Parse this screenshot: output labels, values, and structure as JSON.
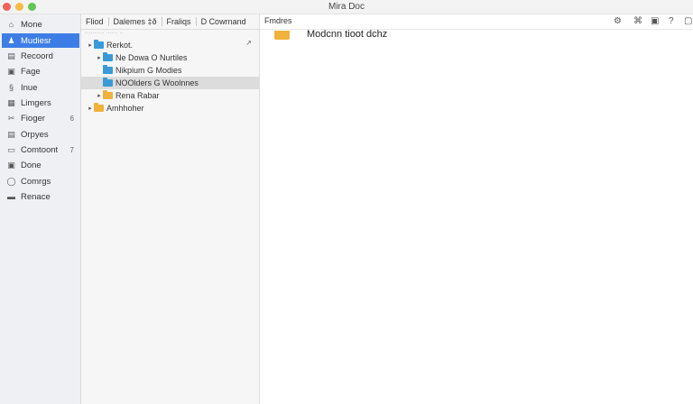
{
  "window": {
    "title": "Mira Doc"
  },
  "sidebar": {
    "items": [
      {
        "label": "Mone",
        "icon": "home-icon",
        "glyph": "⌂"
      },
      {
        "label": "Mudiesr",
        "icon": "user-icon",
        "glyph": "♟",
        "active": true
      },
      {
        "label": "Recoord",
        "icon": "calendar-icon",
        "glyph": "▤"
      },
      {
        "label": "Fage",
        "icon": "image-icon",
        "glyph": "▣"
      },
      {
        "label": "Inue",
        "icon": "tool-icon",
        "glyph": "§"
      },
      {
        "label": "Limgers",
        "icon": "grid-icon",
        "glyph": "▦"
      },
      {
        "label": "Fioger",
        "icon": "pen-icon",
        "glyph": "✂",
        "badge": "6"
      },
      {
        "label": "Orpyes",
        "icon": "list-icon",
        "glyph": "▤"
      },
      {
        "label": "Comtoont",
        "icon": "monitor-icon",
        "glyph": "▭",
        "badge": "7"
      },
      {
        "label": "Done",
        "icon": "document-icon",
        "glyph": "▣"
      },
      {
        "label": "Comrgs",
        "icon": "circle-icon",
        "glyph": "◯"
      },
      {
        "label": "Renace",
        "icon": "archive-icon",
        "glyph": "▬"
      }
    ]
  },
  "tree": {
    "tabs": [
      "Fliod",
      "Dalemes ‡ð",
      "Fraliqs",
      "D Cowrnand"
    ],
    "subheader": "·········· ······ ··",
    "rows": [
      {
        "label": "Rerkot.",
        "caret": "▸",
        "folder": "blue",
        "indent": 6
      },
      {
        "label": "Ne Dowa O Nurtiles",
        "caret": "▸",
        "folder": "blue",
        "indent": 16
      },
      {
        "label": "Nikpium G Modies",
        "caret": "",
        "folder": "blue",
        "indent": 16
      },
      {
        "label": "NOOlders G Woolnnes",
        "caret": "",
        "folder": "blue",
        "indent": 16,
        "selected": true
      },
      {
        "label": "Rena Rabar",
        "caret": "▸",
        "folder": "yellow",
        "indent": 16
      },
      {
        "label": "Amhhoher",
        "caret": "▸",
        "folder": "yellow",
        "indent": 6
      }
    ]
  },
  "main": {
    "tab_label": "Fmdres",
    "document_title": "Modcnn tioot dchz",
    "toolbar": [
      {
        "icon": "settings-icon",
        "glyph": "⚙"
      },
      {
        "icon": "share-icon",
        "glyph": "⌘"
      },
      {
        "icon": "lock-icon",
        "glyph": "▣"
      },
      {
        "icon": "help-icon",
        "glyph": "?"
      },
      {
        "icon": "layout-icon",
        "glyph": "▢"
      }
    ]
  }
}
